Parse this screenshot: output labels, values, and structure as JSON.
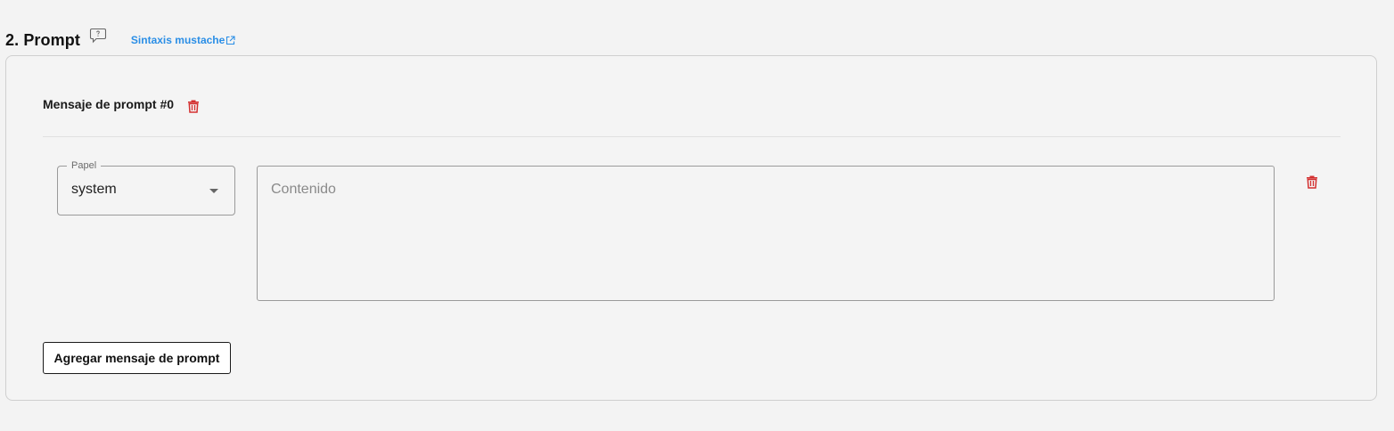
{
  "section": {
    "title": "2. Prompt",
    "help_icon": "comment-question-icon",
    "mustache_link": "Sintaxis mustache",
    "external_icon": "external-link-icon"
  },
  "message": {
    "title": "Mensaje de prompt #0",
    "delete_icon": "trash-icon",
    "role": {
      "label": "Papel",
      "value": "system",
      "caret_icon": "caret-down-icon"
    },
    "content": {
      "placeholder": "Contenido",
      "value": ""
    },
    "row_delete_icon": "trash-icon"
  },
  "actions": {
    "add_message_label": "Agregar mensaje de prompt"
  },
  "colors": {
    "background": "#f3f3f3",
    "link": "#2a8ee6",
    "danger": "#d32f2f",
    "border": "#9a9a9a"
  }
}
